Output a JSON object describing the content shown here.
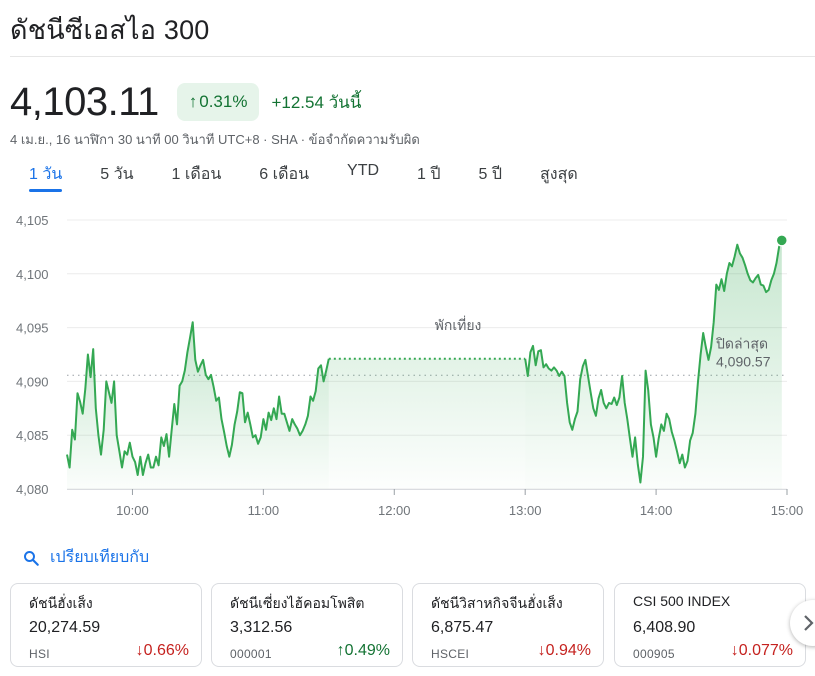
{
  "title": "ดัชนีซีเอสไอ 300",
  "price": "4,103.11",
  "change_pct": "0.31%",
  "change_abs": "+12.54 วันนี้",
  "meta": "4 เม.ย., 16 นาฬิกา 30 นาที 00 วินาที UTC+8 · SHA · ข้อจำกัดความรับผิด",
  "tabs": [
    {
      "label": "1 วัน",
      "active": true
    },
    {
      "label": "5 วัน"
    },
    {
      "label": "1 เดือน"
    },
    {
      "label": "6 เดือน"
    },
    {
      "label": "YTD"
    },
    {
      "label": "1 ปี"
    },
    {
      "label": "5 ปี"
    },
    {
      "label": "สูงสุด"
    }
  ],
  "colors": {
    "up": "#137333",
    "down": "#c5221f",
    "line": "#34a853",
    "accent": "#1a73e8"
  },
  "chart_data": {
    "type": "line",
    "ylim": [
      4080,
      4105
    ],
    "yticks": [
      4080,
      4085,
      4090,
      4095,
      4100,
      4105
    ],
    "ytick_labels": [
      "4,080",
      "4,085",
      "4,090",
      "4,095",
      "4,100",
      "4,105"
    ],
    "xlim": [
      9.5,
      15
    ],
    "xticks": [
      10,
      11,
      12,
      13,
      14,
      15
    ],
    "xtick_labels": [
      "10:00",
      "11:00",
      "12:00",
      "13:00",
      "14:00",
      "15:00"
    ],
    "previous_close": 4090.57,
    "previous_close_label": "ปิดล่าสุด",
    "previous_close_value": "4,090.57",
    "break_label": "พักเที่ยง",
    "break": [
      11.5,
      13.0
    ],
    "break_value": 4092.1,
    "morning": [
      [
        9.5,
        4083.2
      ],
      [
        9.52,
        4082.0
      ],
      [
        9.54,
        4085.5
      ],
      [
        9.56,
        4084.6
      ],
      [
        9.58,
        4088.9
      ],
      [
        9.6,
        4088.1
      ],
      [
        9.62,
        4087.0
      ],
      [
        9.64,
        4089.3
      ],
      [
        9.66,
        4092.5
      ],
      [
        9.68,
        4090.4
      ],
      [
        9.7,
        4093.0
      ],
      [
        9.72,
        4087.5
      ],
      [
        9.74,
        4085.0
      ],
      [
        9.76,
        4083.2
      ],
      [
        9.78,
        4085.5
      ],
      [
        9.8,
        4090.0
      ],
      [
        9.82,
        4089.0
      ],
      [
        9.84,
        4088.0
      ],
      [
        9.86,
        4090.0
      ],
      [
        9.88,
        4085.0
      ],
      [
        9.9,
        4083.5
      ],
      [
        9.92,
        4082.0
      ],
      [
        9.94,
        4083.5
      ],
      [
        9.96,
        4083.2
      ],
      [
        9.98,
        4084.3
      ],
      [
        10.0,
        4083.0
      ],
      [
        10.02,
        4082.5
      ],
      [
        10.04,
        4081.3
      ],
      [
        10.06,
        4083.0
      ],
      [
        10.08,
        4081.3
      ],
      [
        10.1,
        4082.4
      ],
      [
        10.12,
        4083.2
      ],
      [
        10.14,
        4082.0
      ],
      [
        10.16,
        4082.0
      ],
      [
        10.18,
        4083.0
      ],
      [
        10.2,
        4082.2
      ],
      [
        10.22,
        4084.8
      ],
      [
        10.24,
        4084.0
      ],
      [
        10.26,
        4085.1
      ],
      [
        10.28,
        4083.0
      ],
      [
        10.3,
        4085.5
      ],
      [
        10.32,
        4087.9
      ],
      [
        10.34,
        4086.0
      ],
      [
        10.36,
        4089.6
      ],
      [
        10.38,
        4090.0
      ],
      [
        10.4,
        4091.0
      ],
      [
        10.42,
        4092.7
      ],
      [
        10.44,
        4094.1
      ],
      [
        10.46,
        4095.5
      ],
      [
        10.48,
        4092.0
      ],
      [
        10.5,
        4090.9
      ],
      [
        10.52,
        4091.5
      ],
      [
        10.54,
        4092.0
      ],
      [
        10.56,
        4090.6
      ],
      [
        10.58,
        4090.2
      ],
      [
        10.6,
        4090.6
      ],
      [
        10.62,
        4089.5
      ],
      [
        10.64,
        4088.2
      ],
      [
        10.66,
        4088.5
      ],
      [
        10.68,
        4086.5
      ],
      [
        10.7,
        4085.3
      ],
      [
        10.72,
        4084.0
      ],
      [
        10.74,
        4083.0
      ],
      [
        10.76,
        4084.1
      ],
      [
        10.78,
        4086.0
      ],
      [
        10.8,
        4087.2
      ],
      [
        10.82,
        4089.0
      ],
      [
        10.84,
        4088.9
      ],
      [
        10.86,
        4086.2
      ],
      [
        10.88,
        4087.1
      ],
      [
        10.9,
        4086.0
      ],
      [
        10.92,
        4084.8
      ],
      [
        10.94,
        4085.0
      ],
      [
        10.96,
        4084.2
      ],
      [
        10.98,
        4084.8
      ],
      [
        11.0,
        4086.5
      ],
      [
        11.02,
        4085.5
      ],
      [
        11.04,
        4087.1
      ],
      [
        11.06,
        4086.4
      ],
      [
        11.08,
        4087.5
      ],
      [
        11.1,
        4086.5
      ],
      [
        11.12,
        4088.6
      ],
      [
        11.14,
        4087.0
      ],
      [
        11.16,
        4087.0
      ],
      [
        11.18,
        4086.2
      ],
      [
        11.2,
        4085.4
      ],
      [
        11.22,
        4086.5
      ],
      [
        11.24,
        4086.0
      ],
      [
        11.26,
        4085.6
      ],
      [
        11.28,
        4085.0
      ],
      [
        11.3,
        4085.4
      ],
      [
        11.32,
        4086.0
      ],
      [
        11.34,
        4086.8
      ],
      [
        11.36,
        4088.6
      ],
      [
        11.38,
        4088.2
      ],
      [
        11.4,
        4089.1
      ],
      [
        11.42,
        4091.2
      ],
      [
        11.44,
        4091.5
      ],
      [
        11.46,
        4090.0
      ],
      [
        11.48,
        4091.0
      ],
      [
        11.5,
        4092.1
      ]
    ],
    "afternoon": [
      [
        13.0,
        4092.1
      ],
      [
        13.02,
        4090.5
      ],
      [
        13.04,
        4092.7
      ],
      [
        13.06,
        4093.3
      ],
      [
        13.08,
        4091.5
      ],
      [
        13.1,
        4092.8
      ],
      [
        13.12,
        4092.9
      ],
      [
        13.14,
        4091.3
      ],
      [
        13.16,
        4091.6
      ],
      [
        13.18,
        4091.2
      ],
      [
        13.2,
        4091.0
      ],
      [
        13.22,
        4091.3
      ],
      [
        13.24,
        4091.0
      ],
      [
        13.26,
        4090.5
      ],
      [
        13.28,
        4090.9
      ],
      [
        13.3,
        4090.5
      ],
      [
        13.32,
        4088.0
      ],
      [
        13.34,
        4086.2
      ],
      [
        13.36,
        4085.5
      ],
      [
        13.38,
        4086.5
      ],
      [
        13.4,
        4087.2
      ],
      [
        13.42,
        4090.2
      ],
      [
        13.44,
        4091.4
      ],
      [
        13.46,
        4092.0
      ],
      [
        13.48,
        4090.5
      ],
      [
        13.5,
        4089.0
      ],
      [
        13.52,
        4087.5
      ],
      [
        13.54,
        4086.8
      ],
      [
        13.56,
        4088.4
      ],
      [
        13.58,
        4089.2
      ],
      [
        13.6,
        4088.0
      ],
      [
        13.62,
        4087.5
      ],
      [
        13.64,
        4088.0
      ],
      [
        13.66,
        4087.9
      ],
      [
        13.68,
        4088.5
      ],
      [
        13.7,
        4087.8
      ],
      [
        13.72,
        4088.5
      ],
      [
        13.74,
        4090.5
      ],
      [
        13.76,
        4088.0
      ],
      [
        13.78,
        4086.5
      ],
      [
        13.8,
        4084.7
      ],
      [
        13.82,
        4083.0
      ],
      [
        13.84,
        4084.8
      ],
      [
        13.86,
        4082.3
      ],
      [
        13.88,
        4080.6
      ],
      [
        13.9,
        4083.0
      ],
      [
        13.92,
        4091.0
      ],
      [
        13.94,
        4089.2
      ],
      [
        13.96,
        4086.0
      ],
      [
        13.98,
        4084.8
      ],
      [
        14.0,
        4083.0
      ],
      [
        14.02,
        4084.7
      ],
      [
        14.04,
        4086.0
      ],
      [
        14.06,
        4085.4
      ],
      [
        14.08,
        4087.0
      ],
      [
        14.1,
        4086.5
      ],
      [
        14.12,
        4085.3
      ],
      [
        14.14,
        4084.5
      ],
      [
        14.16,
        4083.5
      ],
      [
        14.18,
        4082.4
      ],
      [
        14.2,
        4083.2
      ],
      [
        14.22,
        4082.0
      ],
      [
        14.24,
        4082.6
      ],
      [
        14.26,
        4084.5
      ],
      [
        14.28,
        4085.2
      ],
      [
        14.3,
        4087.0
      ],
      [
        14.32,
        4090.0
      ],
      [
        14.34,
        4092.5
      ],
      [
        14.36,
        4094.5
      ],
      [
        14.38,
        4093.2
      ],
      [
        14.4,
        4092.0
      ],
      [
        14.42,
        4093.2
      ],
      [
        14.44,
        4095.5
      ],
      [
        14.46,
        4099.0
      ],
      [
        14.48,
        4098.5
      ],
      [
        14.5,
        4099.5
      ],
      [
        14.52,
        4098.4
      ],
      [
        14.54,
        4100.0
      ],
      [
        14.56,
        4101.0
      ],
      [
        14.58,
        4100.7
      ],
      [
        14.6,
        4101.6
      ],
      [
        14.62,
        4102.7
      ],
      [
        14.64,
        4101.9
      ],
      [
        14.66,
        4101.5
      ],
      [
        14.68,
        4100.8
      ],
      [
        14.7,
        4100.0
      ],
      [
        14.72,
        4099.4
      ],
      [
        14.74,
        4099.2
      ],
      [
        14.76,
        4099.6
      ],
      [
        14.78,
        4099.9
      ],
      [
        14.8,
        4099.0
      ],
      [
        14.82,
        4098.9
      ],
      [
        14.84,
        4098.3
      ],
      [
        14.86,
        4098.5
      ],
      [
        14.88,
        4099.4
      ],
      [
        14.9,
        4100.0
      ],
      [
        14.92,
        4101.0
      ],
      [
        14.94,
        4102.5
      ],
      [
        14.96,
        4103.11
      ]
    ]
  },
  "compare": {
    "label": "เปรียบเทียบกับ"
  },
  "cards": [
    {
      "name": "ดัชนีฮั่งเส็ง",
      "value": "20,274.59",
      "ticker": "HSI",
      "change": "0.66%",
      "direction": "down"
    },
    {
      "name": "ดัชนีเซี่ยงไฮ้คอมโพสิต",
      "value": "3,312.56",
      "ticker": "000001",
      "change": "0.49%",
      "direction": "up"
    },
    {
      "name": "ดัชนีวิสาหกิจจีนฮั่งเส็ง",
      "value": "6,875.47",
      "ticker": "HSCEI",
      "change": "0.94%",
      "direction": "down"
    },
    {
      "name": "CSI 500 INDEX",
      "value": "6,408.90",
      "ticker": "000905",
      "change": "0.077%",
      "direction": "down"
    }
  ]
}
